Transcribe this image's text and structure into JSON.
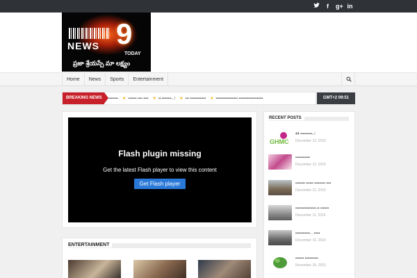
{
  "topbar": {
    "social": [
      {
        "name": "twitter-icon",
        "glyph": "🐦"
      },
      {
        "name": "facebook-icon",
        "glyph": "f"
      },
      {
        "name": "google-plus-icon",
        "glyph": "g+"
      },
      {
        "name": "linkedin-icon",
        "glyph": "in"
      }
    ]
  },
  "logo": {
    "news": "NEWS",
    "nine": "9",
    "today": "TODAY",
    "tagline": "ప్రజా శ్రేయస్సే మా లక్ష్యం"
  },
  "nav": {
    "items": [
      "Home",
      "News",
      "Sports",
      "Entertainment"
    ],
    "search_icon": "search-icon"
  },
  "breaking": {
    "label": "BREAKING NEWS",
    "items": [
      "••••••••",
      "••••••• •••• ••••",
      "••.••••••••...!",
      "••• •••••••••••••",
      "•••••••••••••••••• ••••••••••••••••••••"
    ]
  },
  "clock": "GMT+2 09:51",
  "flash": {
    "title": "Flash plugin missing",
    "subtitle": "Get the latest Flash player to view this content",
    "button": "Get Flash player"
  },
  "entertainment": {
    "title": "ENTERTAINMENT"
  },
  "recent": {
    "title": "RECENT POSTS",
    "posts": [
      {
        "title": "44 ••••••••••..!",
        "date": "December 12, 2015",
        "color": "#6fb83a"
      },
      {
        "title": "••••••••••••",
        "date": "December 12, 2015",
        "color": "#c24a8c"
      },
      {
        "title": "•••••••• •••••• ••••••••• ••••",
        "date": "December 11, 2015",
        "color": "#7a6a55"
      },
      {
        "title": "•••••••••••••••••.•• •••••••",
        "date": "December 11, 2015",
        "color": "#8a8a8a"
      },
      {
        "title": "••••••••••••... •••••",
        "date": "December 10, 2015",
        "color": "#6a6a6a"
      },
      {
        "title": "••••••• •••••••••••",
        "date": "November 30, 2015",
        "color": "#4f9b3a"
      }
    ]
  },
  "colors": {
    "accent": "#c8202a",
    "topbar": "#2f3338",
    "button": "#2a79d8"
  }
}
